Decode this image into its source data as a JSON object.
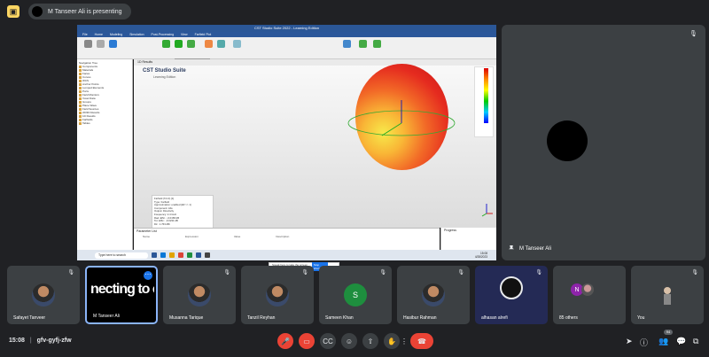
{
  "banner": {
    "presenting_text": "M Tanseer Ali is presenting"
  },
  "shared_screen": {
    "window_title": "CST Studio Suite 2022 - Learning Edition",
    "ribbon_tabs": [
      "File",
      "Home",
      "Modeling",
      "Simulation",
      "Post-Processing",
      "View",
      "Farfield Plot"
    ],
    "viewport_tab": "1D Results",
    "logo_title": "CST Studio Suite",
    "logo_subtitle": "Learning Edition",
    "popup_title": "Farfield",
    "popup_item": "Farfield Plot",
    "nav_tree_title": "Navigation Tree",
    "nav_tree_items": [
      "Components",
      "Materials",
      "Faces",
      "Curves",
      "WCS",
      "Anchor Points",
      "Lumped Elements",
      "Ports",
      "Field Monitors",
      "Voxel Data",
      "Groups",
      "Plane Wave",
      "Field Sources",
      "2D/3D Results",
      "1D Results",
      "Farfields",
      "Tables"
    ],
    "info_box_lines": [
      "Farfield (f=2.4) [1]",
      "Type: Farfield",
      "Approximation: enabled (kR >> 1)",
      "Component: Abs",
      "Output: Directivity",
      "Frequency: 2.4 GHz",
      "Rad. Effic.: -0.0158 dB",
      "Tot. Effic.: -0.0234 dB",
      "Dir.: 1.763 dBi"
    ],
    "param_panel_title": "Parameter List",
    "param_columns": [
      "Name",
      "Expression",
      "Value",
      "Description"
    ],
    "progress_title": "Progress",
    "taskbar_search": "Type here to search",
    "taskbar_time": "15:08",
    "taskbar_date": "4/28/2023",
    "notif_text": "Speak here to take the screen sharing",
    "notif_button": "Stop sharing",
    "notif_hide": "Hide"
  },
  "big_tile": {
    "name": "M Tanseer Ali"
  },
  "participants": [
    {
      "name": "Safayet Tanveer"
    },
    {
      "name": "M Tanseer Ali",
      "overlay_text": "necting to camera."
    },
    {
      "name": "Musanna Tarique"
    },
    {
      "name": "Tanzil Reyhan"
    },
    {
      "name": "Sameen Khan",
      "initial": "S"
    },
    {
      "name": "Hasibur Rahman"
    },
    {
      "name": "alhasan alrefi"
    },
    {
      "name": "85 others",
      "initial": "N"
    },
    {
      "name": "You"
    }
  ],
  "bottom_bar": {
    "time": "15:08",
    "meeting_code": "gfv-gyfj-zfw",
    "people_count": "94"
  },
  "colors": {
    "background": "#202124",
    "tile": "#3c4043",
    "end_call": "#ea4335",
    "active_border": "#8ab4f8"
  }
}
